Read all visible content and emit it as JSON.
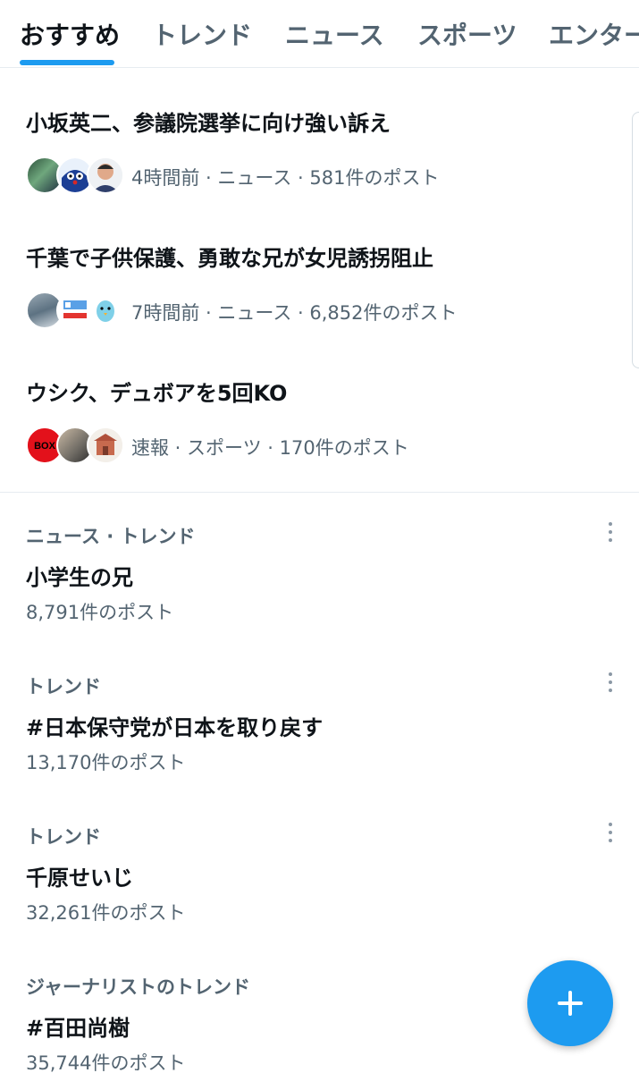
{
  "tabs": [
    {
      "label": "おすすめ",
      "active": true
    },
    {
      "label": "トレンド",
      "active": false
    },
    {
      "label": "ニュース",
      "active": false
    },
    {
      "label": "スポーツ",
      "active": false
    },
    {
      "label": "エンター",
      "active": false
    }
  ],
  "stories": [
    {
      "title": "小坂英二、参議院選挙に向け強い訴え",
      "meta": "4時間前 · ニュース · 581件のポスト",
      "avatar_icons": [
        "avatar-landscape-icon",
        "avatar-cartoon-icon",
        "avatar-person-icon"
      ]
    },
    {
      "title": "千葉で子供保護、勇敢な兄が女児誘拐阻止",
      "meta": "7時間前 · ニュース · 6,852件のポスト",
      "avatar_icons": [
        "avatar-car-icon",
        "avatar-news-logo-icon",
        "avatar-bird-icon"
      ]
    },
    {
      "title": "ウシク、デュボアを5回KO",
      "meta": "速報 · スポーツ · 170件のポスト",
      "avatar_icons": [
        "avatar-box-logo-icon",
        "avatar-photo-icon",
        "avatar-building-icon"
      ],
      "box_text": "BOX"
    }
  ],
  "trends": [
    {
      "category": "ニュース · トレンド",
      "name": "小学生の兄",
      "count": "8,791件のポスト"
    },
    {
      "category": "トレンド",
      "name": "#日本保守党が日本を取り戻す",
      "count": "13,170件のポスト"
    },
    {
      "category": "トレンド",
      "name": "千原せいじ",
      "count": "32,261件のポスト"
    },
    {
      "category": "ジャーナリストのトレンド",
      "name": "#百田尚樹",
      "count": "35,744件のポスト"
    }
  ],
  "colors": {
    "accent": "#1d9bf0",
    "secondary_text": "#536471",
    "primary_text": "#0f1419"
  }
}
